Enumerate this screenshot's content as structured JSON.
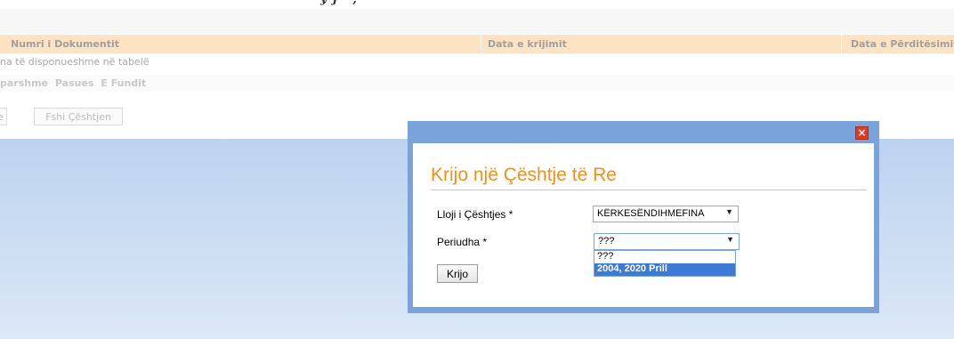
{
  "table": {
    "columns": [
      "Numri i Dokumentit",
      "Data e krijimit",
      "Data e Përditësimit"
    ],
    "empty_message": "na të disponueshme në tabelë",
    "pager": [
      "parshme",
      "Pasues",
      "E Fundit"
    ]
  },
  "actions": {
    "partial_button": "e",
    "delete_button": "Fshi Çështjen"
  },
  "modal": {
    "title": "Krijo një Çështje të Re",
    "close_symbol": "×",
    "fields": {
      "case_type_label": "Lloji i Çështjes *",
      "case_type_value": "KËRKESËNDIHMEFINA",
      "period_label": "Periudha *",
      "period_value": "???"
    },
    "period_options": [
      "???",
      "2004, 2020 Prill"
    ],
    "period_selected_index": 1,
    "submit_label": "Krijo"
  },
  "colors": {
    "accent": "#f29018",
    "modal_border": "#7ba3db",
    "header_bg": "#fde3c1",
    "selected_option": "#3b7ad6",
    "close_button": "#e23a1e"
  }
}
